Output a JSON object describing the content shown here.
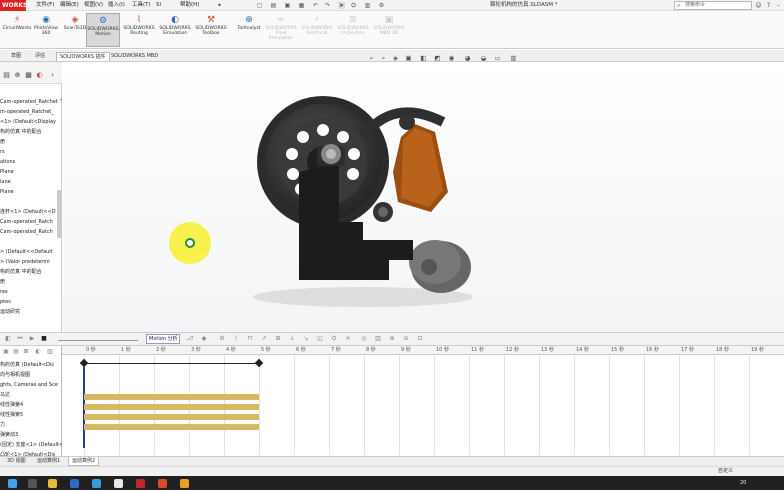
{
  "titlebar": {
    "logo": "WORKS",
    "menus": [
      "文件(F)",
      "编辑(E)",
      "视图(V)",
      "插入(I)",
      "工具(T)",
      "Si",
      "帮助(H)"
    ],
    "document_title": "棘轮机构的仿真.SLDASM *",
    "search_placeholder": "搜索命令"
  },
  "ribbon": {
    "buttons": [
      {
        "label": "CircuitWorks",
        "icon": "circuit-icon"
      },
      {
        "label": "PhotoView 360",
        "icon": "photoview-icon"
      },
      {
        "label": "ScanTo3D",
        "icon": "scan-icon"
      },
      {
        "label": "SOLIDWORKS Motion",
        "icon": "motion-icon",
        "active": true
      },
      {
        "label": "SOLIDWORKS Routing",
        "icon": "routing-icon"
      },
      {
        "label": "SOLIDWORKS Simulation",
        "icon": "simulation-icon"
      },
      {
        "label": "SOLIDWORKS Toolbox",
        "icon": "toolbox-icon"
      },
      {
        "label": "TolAnalyst",
        "icon": "tolanalyst-icon"
      },
      {
        "label": "SOLIDWORKS Flow Simulation",
        "icon": "flow-icon",
        "disabled": true
      },
      {
        "label": "SOLIDWORKS Electrical",
        "icon": "electrical-icon",
        "disabled": true
      },
      {
        "label": "SOLIDWORKS Inspection",
        "icon": "inspection-icon",
        "disabled": true
      },
      {
        "label": "SOLIDWORKS MBD 3D",
        "icon": "mbd-icon",
        "disabled": true
      }
    ]
  },
  "tabs": [
    "草图",
    "评估",
    "SOLIDWORKS 插件",
    "SOLIDWORKS MBD"
  ],
  "feature_tree": [
    "Cam-operated_Ratchet ^",
    "m-operated_Ratchet_",
    "<1> (Default<Display",
    "构的仿真 中的配合",
    "册",
    "rs",
    "ations",
    "Plane",
    "lane",
    "Plane",
    "",
    "连杆<1> (Default<<D",
    "Cam-operated_Ratch",
    "Cam-operated_Ratch",
    "",
    "> (Default<<Default",
    "> (Valor predetermi",
    "构的仿真 中的配合",
    "册",
    "res",
    "ptes",
    "运动研究"
  ],
  "motion": {
    "type": "Motion 分析",
    "tree": [
      "构的仿真 (Default<Dis",
      "向与相机视图",
      "ghts, Cameras and Sce",
      "马达",
      "线性弹簧4",
      "线性弹簧5",
      "力",
      "弹簧动3",
      "(固定) 支座<1> (Default<",
      "凸轮<1> (Default<Dis"
    ],
    "ruler_ticks": [
      "0 秒",
      "1 秒",
      "2 秒",
      "3 秒",
      "4 秒",
      "5 秒",
      "6 秒",
      "7 秒",
      "8 秒",
      "9 秒",
      "10 秒",
      "11 秒",
      "12 秒",
      "13 秒",
      "14 秒",
      "15 秒",
      "16 秒",
      "17 秒",
      "18 秒",
      "19 秒",
      "20 秒"
    ]
  },
  "bottom_tabs": [
    "3D 视图",
    "运动算例1",
    "运动算例2"
  ],
  "status": {
    "right_text": "自定义"
  },
  "taskbar": {
    "clock": "20"
  }
}
